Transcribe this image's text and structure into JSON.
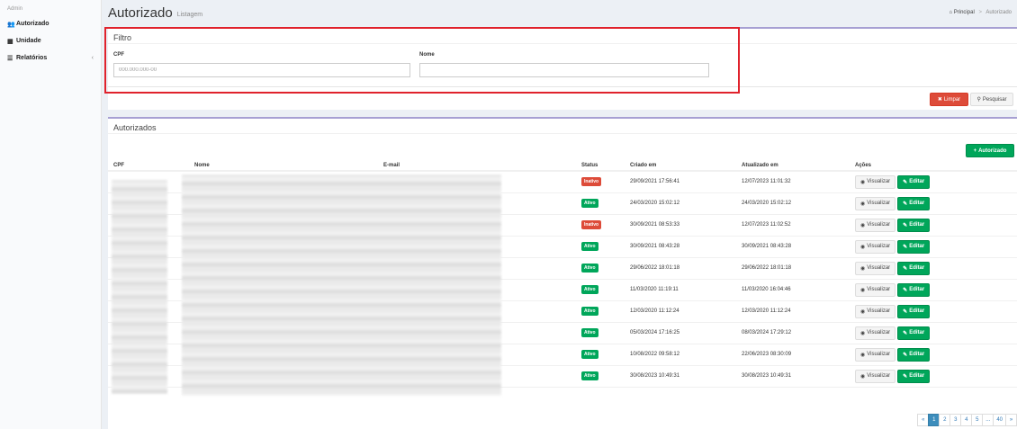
{
  "sidebar": {
    "brand": "Admin",
    "items": [
      {
        "label": "Autorizado",
        "icon": "users-icon"
      },
      {
        "label": "Unidade",
        "icon": "building-icon"
      },
      {
        "label": "Relatórios",
        "icon": "book-icon",
        "chevron": "‹"
      }
    ]
  },
  "header": {
    "title": "Autorizado",
    "subtitle": "Listagem",
    "breadcrumb": [
      "Principal",
      "Autorizado"
    ]
  },
  "filter": {
    "title": "Filtro",
    "cpf_label": "CPF",
    "cpf_placeholder": "000.000.000-00",
    "nome_label": "Nome",
    "nome_value": ""
  },
  "actions": {
    "limpar_label": "Limpar",
    "pesquisar_label": "Pesquisar"
  },
  "list": {
    "title": "Autorizados",
    "add_label": "Autorizado",
    "columns": [
      "CPF",
      "Nome",
      "E-mail",
      "Status",
      "Criado em",
      "Atualizado em",
      "Ações"
    ],
    "view_label": "Visualizar",
    "edit_label": "Editar",
    "rows": [
      {
        "status": "Inativo",
        "created": "29/09/2021 17:56:41",
        "updated": "12/07/2023 11:01:32"
      },
      {
        "status": "Ativo",
        "created": "24/03/2020 15:02:12",
        "updated": "24/03/2020 15:02:12"
      },
      {
        "status": "Inativo",
        "created": "30/09/2021 08:53:33",
        "updated": "12/07/2023 11:02:52"
      },
      {
        "status": "Ativo",
        "created": "30/09/2021 08:43:28",
        "updated": "30/09/2021 08:43:28"
      },
      {
        "status": "Ativo",
        "created": "29/06/2022 18:01:18",
        "updated": "29/06/2022 18:01:18"
      },
      {
        "status": "Ativo",
        "created": "11/03/2020 11:19:11",
        "updated": "11/03/2020 16:04:46"
      },
      {
        "status": "Ativo",
        "created": "12/03/2020 11:12:24",
        "updated": "12/03/2020 11:12:24"
      },
      {
        "status": "Ativo",
        "created": "05/03/2024 17:16:25",
        "updated": "08/03/2024 17:29:12"
      },
      {
        "status": "Ativo",
        "created": "10/08/2022 09:58:12",
        "updated": "22/06/2023 08:30:09"
      },
      {
        "status": "Ativo",
        "created": "30/08/2023 10:49:31",
        "updated": "30/08/2023 10:49:31"
      }
    ]
  },
  "pagination": [
    "«",
    "1",
    "2",
    "3",
    "4",
    "5",
    "...",
    "40",
    "»"
  ],
  "colors": {
    "primary_border": "#a7a0d3",
    "success": "#00a65a",
    "danger": "#dd4b39",
    "highlight": "#e0222c"
  }
}
